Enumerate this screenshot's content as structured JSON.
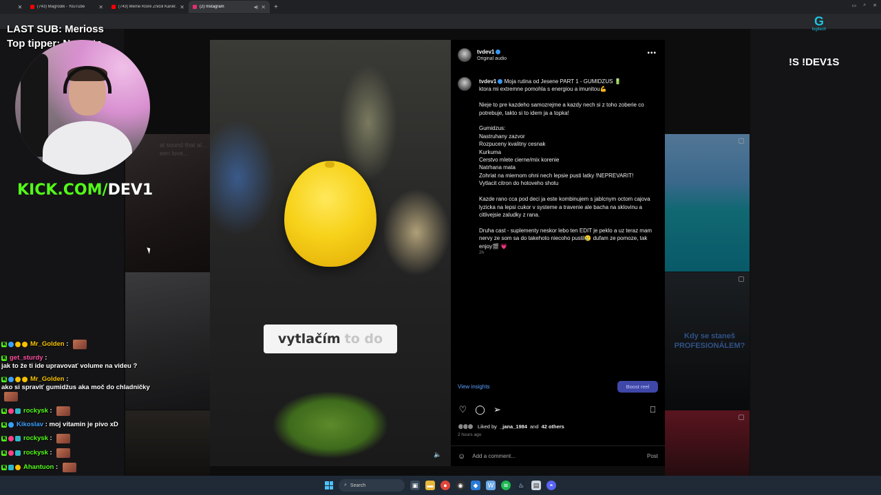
{
  "browser": {
    "tabs": [
      {
        "title": "(743) Magrodik - YouTube",
        "favicon_color": "#ff0000",
        "active": false
      },
      {
        "title": "(743) Meme Ktoré Zničili Kariér...",
        "favicon_color": "#ff0000",
        "active": false
      },
      {
        "title": "(2) Instagram",
        "favicon_color": "#e1306c",
        "active": true
      }
    ],
    "new_tab_label": "+"
  },
  "stream_overlay": {
    "last_sub": "LAST SUB: Merioss",
    "top_tipper": "Top tipper: No Data",
    "kick_prefix": "KICK.COM/",
    "kick_name": "DEV1",
    "command": "!S !DEV1S",
    "logo_text": "logitech"
  },
  "background_thumbs": {
    "faint_text": "al sound that al... een love...",
    "caption": "Kdy se staneš PROFESIONÁLEM?"
  },
  "reel": {
    "subtitle_highlight": "vytlačím",
    "subtitle_rest": "to do"
  },
  "post": {
    "username": "tvdev1",
    "audio": "Original audio",
    "caption_text": "Moja rutina od Jesene PART 1 - GUMIDZUS 🔋\nktora mi extremne pomohla s energiou a imunitou💪\n\nNieje to pre kazdeho samozrejme a kazdy nech si z toho zoberie co potrebuje, takto si to idem ja a topka!\n\nGumidzus:\nNastruhany zazvor\nRozpuceny kvalitny cesnak\nKurkuma\nCerstvo mlete cierne/mix korenie\nNatrhana mata\nZohriat na miernom ohni nech lepsie pusti latky !NEPREVARIT!\nVytlacit citron do hotoveho shotu\n\nKazde rano cca pod deci ja este kombinujem s jablcnym octom cajova lyzicka na lepsi cukor v systeme a travenie ale bacha na sklovinu a citlivejsie zaludky z rana.\n\nDruha cast - suplementy neskor lebo ten EDIT je peklo a uz teraz mam nervy ze som sa do takehoto niecoho pustil🥲 dufam ze pomoze, tak enjoy🎬 💗",
    "time": "2h",
    "insights_label": "View insights",
    "boost_label": "Boost reel",
    "liked_prefix": "Liked by",
    "liked_user": "_jana_1984",
    "liked_and": "and",
    "liked_others": "42 others",
    "ago": "2 hours ago",
    "comment_placeholder": "Add a comment...",
    "post_label": "Post"
  },
  "chat": [
    {
      "badges": [
        "kick",
        "blue",
        "gold",
        "gold"
      ],
      "name": "Mr_Golden",
      "color": "#f6c200",
      "text": "",
      "emote": true
    },
    {
      "badges": [
        "kick"
      ],
      "name": "get_sturdy",
      "color": "#ff4fa3",
      "text": "jak to že ti ide upravovať volume na videu ?",
      "emote": false
    },
    {
      "badges": [
        "kick",
        "blue",
        "gold",
        "gold"
      ],
      "name": "Mr_Golden",
      "color": "#f6c200",
      "text": "ako si spraviť gumidžus aka moč do chladničky",
      "emote": true
    },
    {
      "badges": [
        "kick",
        "pink",
        "teal"
      ],
      "name": "rockysk",
      "color": "#53fc18",
      "text": "",
      "emote": true
    },
    {
      "badges": [
        "kick",
        "blue"
      ],
      "name": "Kikoslav",
      "color": "#3aa0ff",
      "text": "moj vitamin je pivo xD",
      "emote": false
    },
    {
      "badges": [
        "kick",
        "pink",
        "teal"
      ],
      "name": "rockysk",
      "color": "#53fc18",
      "text": "",
      "emote": true
    },
    {
      "badges": [
        "kick",
        "pink",
        "teal"
      ],
      "name": "rockysk",
      "color": "#53fc18",
      "text": "",
      "emote": true
    },
    {
      "badges": [
        "kick",
        "teal",
        "gold"
      ],
      "name": "Ahantuon",
      "color": "#53fc18",
      "text": "",
      "emote": true
    },
    {
      "badges": [
        "kick",
        "pink",
        "teal"
      ],
      "name": "rockysk",
      "color": "#53fc18",
      "text": "",
      "emote": true
    }
  ],
  "taskbar": {
    "search_label": "Search"
  }
}
